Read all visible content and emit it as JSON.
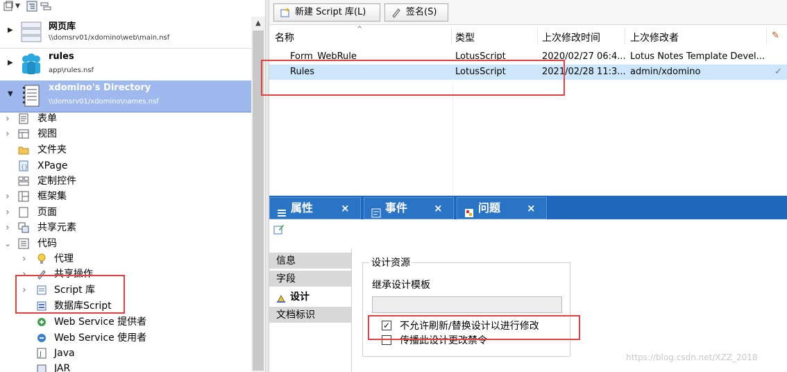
{
  "navigator": {
    "databases": [
      {
        "title": "网页库",
        "path": "\\\\domsrv01/xdomino\\web\\main.nsf"
      },
      {
        "title": "rules",
        "path": "app\\rules.nsf"
      },
      {
        "title": "xdomino's Directory",
        "path": "\\\\domsrv01/xdomino\\names.nsf"
      }
    ],
    "tree": {
      "forms": "表单",
      "views": "视图",
      "folders": "文件夹",
      "xpage": "XPage",
      "custom_controls": "定制控件",
      "framesets": "框架集",
      "pages": "页面",
      "shared_elements": "共享元素",
      "code": "代码",
      "agents": "代理",
      "shared_actions": "共享操作",
      "script_libraries": "Script 库",
      "database_script": "数据库Script",
      "web_service_providers": "Web Service 提供者",
      "web_service_consumers": "Web Service 使用者",
      "java": "Java",
      "jar": "JAR"
    }
  },
  "toolbar": {
    "new_script_library": "新建 Script 库(L)",
    "sign": "签名(S)"
  },
  "list": {
    "columns": [
      "名称",
      "类型",
      "上次修改时间",
      "上次修改者"
    ],
    "rows": [
      {
        "name": "Form_WebRule",
        "type": "LotusScript",
        "modified": "2020/02/27 06:4...",
        "modified_by": "Lotus Notes Template Devel..."
      },
      {
        "name": "Rules",
        "type": "LotusScript",
        "modified": "2021/02/28 11:3...",
        "modified_by": "admin/xdomino",
        "check": "✓"
      }
    ]
  },
  "bottom_tabs": [
    {
      "label": "属性",
      "close": "×"
    },
    {
      "label": "事件",
      "close": "×"
    },
    {
      "label": "问题",
      "close": "×"
    }
  ],
  "properties": {
    "tabs": [
      "信息",
      "字段",
      "设计",
      "文档标识"
    ],
    "active_tab": "设计",
    "group_title": "设计资源",
    "inherit_label": "继承设计模板",
    "inherit_value": "",
    "options": [
      {
        "label": "不允许刷新/替换设计以进行修改",
        "checked": true,
        "mark": "✓"
      },
      {
        "label": "传播此设计更改禁令",
        "checked": false,
        "mark": ""
      }
    ]
  },
  "watermark": "https://blog.csdn.net/XZZ_2018",
  "colors": {
    "tab_bar": "#1e68bd",
    "selected_db": "#9fb8ee",
    "selected_row": "#cde6fb",
    "highlight_box": "#e04040"
  }
}
